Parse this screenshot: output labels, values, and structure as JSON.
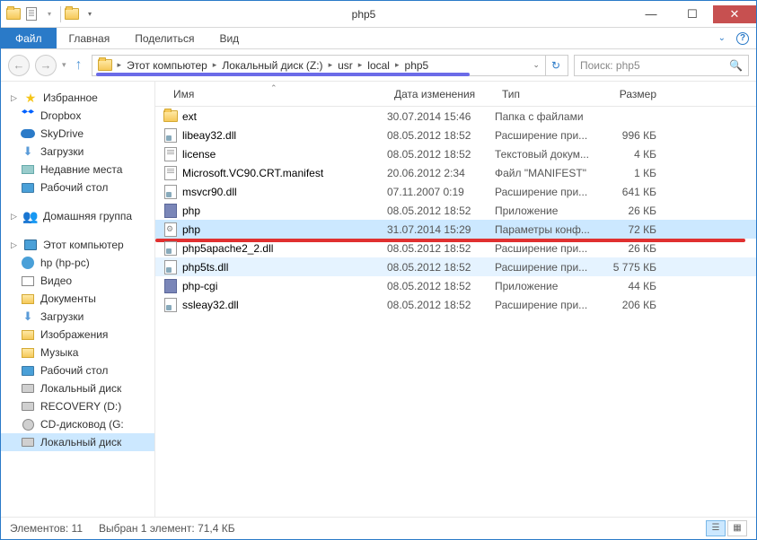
{
  "window": {
    "title": "php5"
  },
  "ribbon": {
    "file": "Файл",
    "tabs": [
      "Главная",
      "Поделиться",
      "Вид"
    ]
  },
  "breadcrumbs": [
    "Этот компьютер",
    "Локальный диск (Z:)",
    "usr",
    "local",
    "php5"
  ],
  "search": {
    "placeholder": "Поиск: php5"
  },
  "sidebar": {
    "favorites": {
      "label": "Избранное",
      "items": [
        {
          "icon": "dropbox",
          "label": "Dropbox"
        },
        {
          "icon": "skydrive",
          "label": "SkyDrive"
        },
        {
          "icon": "download",
          "label": "Загрузки"
        },
        {
          "icon": "recent",
          "label": "Недавние места"
        },
        {
          "icon": "desktop",
          "label": "Рабочий стол"
        }
      ]
    },
    "homegroup": {
      "label": "Домашняя группа"
    },
    "thispc": {
      "label": "Этот компьютер",
      "items": [
        {
          "icon": "hp",
          "label": "hp (hp-pc)"
        },
        {
          "icon": "video",
          "label": "Видео"
        },
        {
          "icon": "docs",
          "label": "Документы"
        },
        {
          "icon": "download",
          "label": "Загрузки"
        },
        {
          "icon": "images",
          "label": "Изображения"
        },
        {
          "icon": "music",
          "label": "Музыка"
        },
        {
          "icon": "desktop",
          "label": "Рабочий стол"
        },
        {
          "icon": "disk",
          "label": "Локальный диск"
        },
        {
          "icon": "disk",
          "label": "RECOVERY (D:)"
        },
        {
          "icon": "cd",
          "label": "CD-дисковод (G:"
        },
        {
          "icon": "disk",
          "label": "Локальный диск",
          "selected": true
        }
      ]
    }
  },
  "columns": {
    "name": "Имя",
    "date": "Дата изменения",
    "type": "Тип",
    "size": "Размер"
  },
  "files": [
    {
      "icon": "folder",
      "name": "ext",
      "date": "30.07.2014 15:46",
      "type": "Папка с файлами",
      "size": ""
    },
    {
      "icon": "dll",
      "name": "libeay32.dll",
      "date": "08.05.2012 18:52",
      "type": "Расширение при...",
      "size": "996 КБ"
    },
    {
      "icon": "txt",
      "name": "license",
      "date": "08.05.2012 18:52",
      "type": "Текстовый докум...",
      "size": "4 КБ"
    },
    {
      "icon": "txt",
      "name": "Microsoft.VC90.CRT.manifest",
      "date": "20.06.2012 2:34",
      "type": "Файл \"MANIFEST\"",
      "size": "1 КБ"
    },
    {
      "icon": "dll",
      "name": "msvcr90.dll",
      "date": "07.11.2007 0:19",
      "type": "Расширение при...",
      "size": "641 КБ"
    },
    {
      "icon": "php",
      "name": "php",
      "date": "08.05.2012 18:52",
      "type": "Приложение",
      "size": "26 КБ"
    },
    {
      "icon": "cfg",
      "name": "php",
      "date": "31.07.2014 15:29",
      "type": "Параметры конф...",
      "size": "72 КБ",
      "selected": true
    },
    {
      "icon": "dll",
      "name": "php5apache2_2.dll",
      "date": "08.05.2012 18:52",
      "type": "Расширение при...",
      "size": "26 КБ"
    },
    {
      "icon": "dll",
      "name": "php5ts.dll",
      "date": "08.05.2012 18:52",
      "type": "Расширение при...",
      "size": "5 775 КБ",
      "hover": true
    },
    {
      "icon": "php",
      "name": "php-cgi",
      "date": "08.05.2012 18:52",
      "type": "Приложение",
      "size": "44 КБ"
    },
    {
      "icon": "dll",
      "name": "ssleay32.dll",
      "date": "08.05.2012 18:52",
      "type": "Расширение при...",
      "size": "206 КБ"
    }
  ],
  "status": {
    "count": "Элементов: 11",
    "selection": "Выбран 1 элемент: 71,4 КБ"
  }
}
